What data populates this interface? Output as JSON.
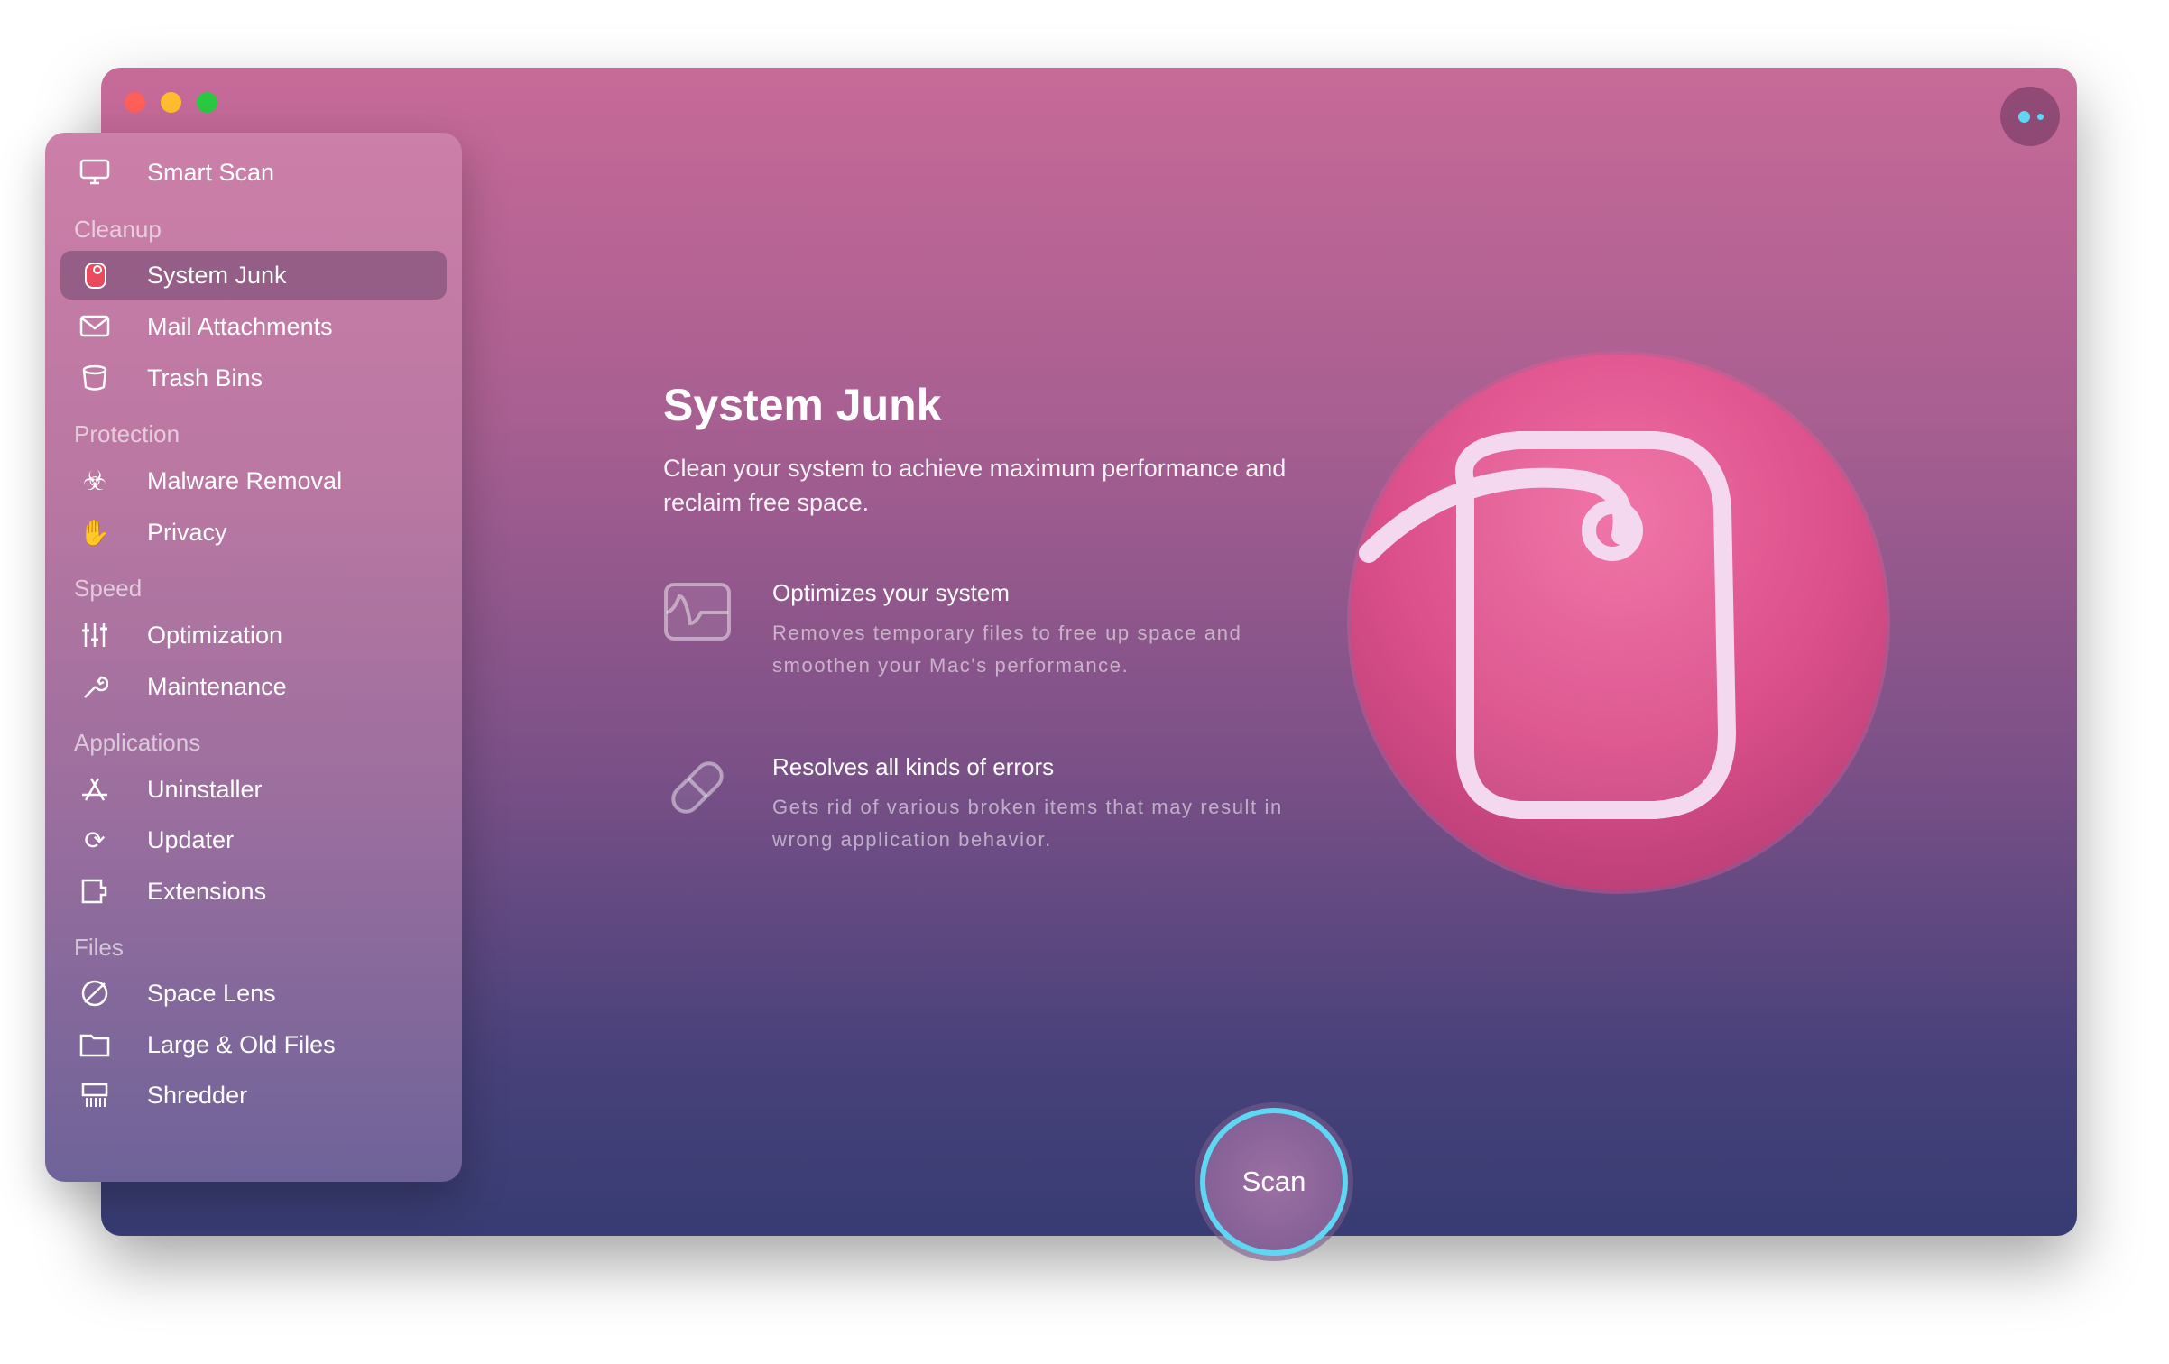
{
  "window": {
    "traffic_lights": {
      "close": "#fe5f57",
      "minimize": "#febc2e",
      "zoom": "#28c840"
    }
  },
  "sidebar": {
    "smart_scan": "Smart Scan",
    "sections": [
      {
        "header": "Cleanup",
        "items": [
          "System Junk",
          "Mail Attachments",
          "Trash Bins"
        ]
      },
      {
        "header": "Protection",
        "items": [
          "Malware Removal",
          "Privacy"
        ]
      },
      {
        "header": "Speed",
        "items": [
          "Optimization",
          "Maintenance"
        ]
      },
      {
        "header": "Applications",
        "items": [
          "Uninstaller",
          "Updater",
          "Extensions"
        ]
      },
      {
        "header": "Files",
        "items": [
          "Space Lens",
          "Large & Old Files",
          "Shredder"
        ]
      }
    ],
    "selected": "System Junk"
  },
  "main": {
    "title": "System Junk",
    "subtitle": "Clean your system to achieve maximum performance and reclaim free space.",
    "features": [
      {
        "icon": "pulse-monitor-icon",
        "title": "Optimizes your system",
        "description": "Removes temporary files to free up space and smoothen your Mac's performance."
      },
      {
        "icon": "pill-icon",
        "title": "Resolves all kinds of errors",
        "description": "Gets rid of various broken items that may result in wrong application behavior."
      }
    ],
    "scan_button": "Scan"
  },
  "colors": {
    "accent_ring": "#5fd6f2",
    "hero": "#e05590"
  }
}
